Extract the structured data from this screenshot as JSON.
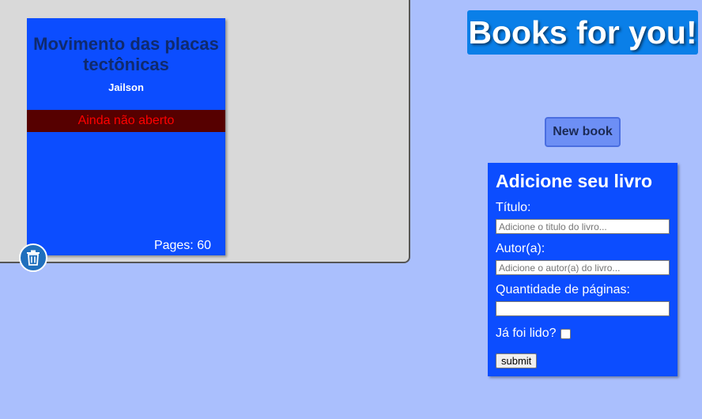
{
  "header": {
    "title": "Books for you!"
  },
  "library": {
    "books": [
      {
        "title": "Movimento das placas tectônicas",
        "author": "Jailson",
        "status": "Ainda não aberto",
        "pages_label": "Pages: 60"
      }
    ],
    "delete_icon": "trash-icon"
  },
  "actions": {
    "new_book_label": "New book"
  },
  "form": {
    "heading": "Adicione seu livro",
    "title_label": "Título:",
    "title_placeholder": "Adicione o titulo do livro...",
    "author_label": "Autor(a):",
    "author_placeholder": "Adicione o autor(a) do livro...",
    "pages_label": "Quantidade de páginas:",
    "pages_value": "",
    "read_label": "Já foi lido?",
    "read_checked": false,
    "submit_label": "submit"
  },
  "colors": {
    "page_background": "#aabffd",
    "shelf_background": "#d9d9d9",
    "card_blue": "#0c4dff",
    "title_badge": "#0a7fe8",
    "status_bar": "#560000",
    "status_text": "#ff0000"
  }
}
